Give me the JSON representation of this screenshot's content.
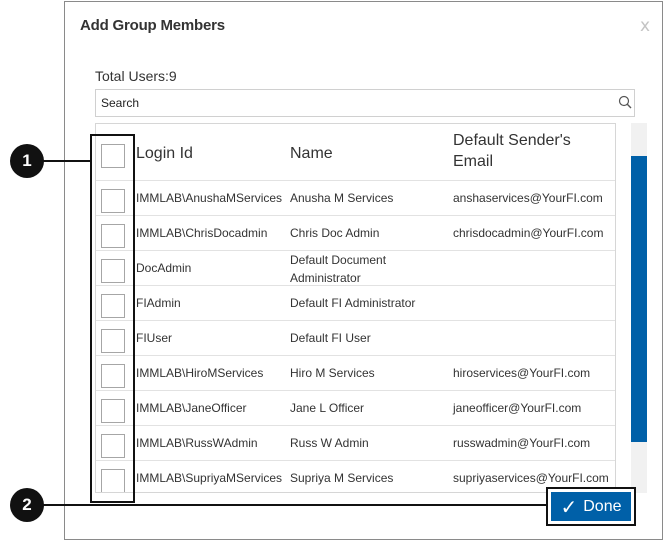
{
  "dialog": {
    "title": "Add Group Members",
    "close_label": "x",
    "total_users_label": "Total Users:9",
    "search": {
      "placeholder": "Search",
      "value": ""
    },
    "columns": [
      "Login Id",
      "Name",
      "Default Sender's Email"
    ],
    "rows": [
      {
        "login": "IMMLAB\\AnushaMServices",
        "name": "Anusha M Services",
        "email": "anshaservices@YourFI.com"
      },
      {
        "login": "IMMLAB\\ChrisDocadmin",
        "name": "Chris Doc Admin",
        "email": "chrisdocadmin@YourFI.com"
      },
      {
        "login": "DocAdmin",
        "name": "Default Document Administrator",
        "email": ""
      },
      {
        "login": "FIAdmin",
        "name": "Default FI Administrator",
        "email": ""
      },
      {
        "login": "FIUser",
        "name": "Default FI User",
        "email": ""
      },
      {
        "login": "IMMLAB\\HiroMServices",
        "name": "Hiro M Services",
        "email": "hiroservices@YourFI.com"
      },
      {
        "login": "IMMLAB\\JaneOfficer",
        "name": "Jane L Officer",
        "email": "janeofficer@YourFI.com"
      },
      {
        "login": "IMMLAB\\RussWAdmin",
        "name": "Russ W Admin",
        "email": "russwadmin@YourFI.com"
      },
      {
        "login": "IMMLAB\\SupriyaMServices",
        "name": "Supriya M Services",
        "email": "supriyaservices@YourFI.com"
      }
    ],
    "done_label": "Done",
    "done_icon": "check-icon"
  },
  "callouts": [
    {
      "number": "1"
    },
    {
      "number": "2"
    }
  ],
  "colors": {
    "accent": "#0060a8",
    "callout": "#111111"
  }
}
